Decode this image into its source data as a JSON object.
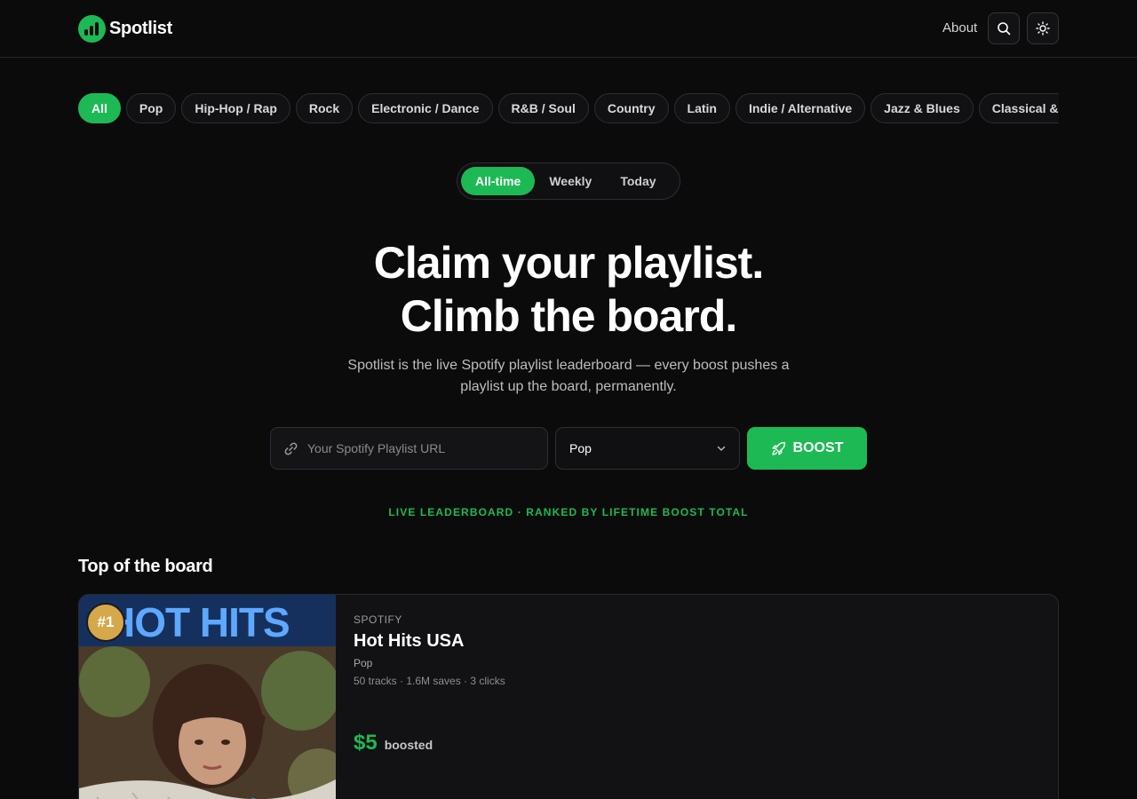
{
  "brand": {
    "name": "Spotlist"
  },
  "nav": {
    "about": "About"
  },
  "genres": [
    "All",
    "Pop",
    "Hip-Hop / Rap",
    "Rock",
    "Electronic / Dance",
    "R&B / Soul",
    "Country",
    "Latin",
    "Indie / Alternative",
    "Jazz & Blues",
    "Classical &"
  ],
  "period": {
    "options": [
      "All-time",
      "Weekly",
      "Today"
    ],
    "selected": "All-time"
  },
  "hero": {
    "line1": "Claim your playlist.",
    "line2": "Climb the board.",
    "subtitle": "Spotlist is the live Spotify playlist leaderboard — every boost pushes a playlist up the board, permanently."
  },
  "form": {
    "url_placeholder": "Your Spotify Playlist URL",
    "genre_selected": "Pop",
    "boost_label": "BOOST"
  },
  "tagline": "LIVE LEADERBOARD · RANKED BY LIFETIME BOOST TOTAL",
  "section_title": "Top of the board",
  "top_playlist": {
    "rank": "#1",
    "cover_text": "HOT HITS",
    "source": "SPOTIFY",
    "title": "Hot Hits USA",
    "genre": "Pop",
    "meta": "50 tracks · 1.6M saves · 3 clicks",
    "amount": "$5",
    "boosted_label": "boosted"
  },
  "colors": {
    "accent": "#1db954",
    "background": "#0b0b0c",
    "gold": "#d4a84b"
  }
}
